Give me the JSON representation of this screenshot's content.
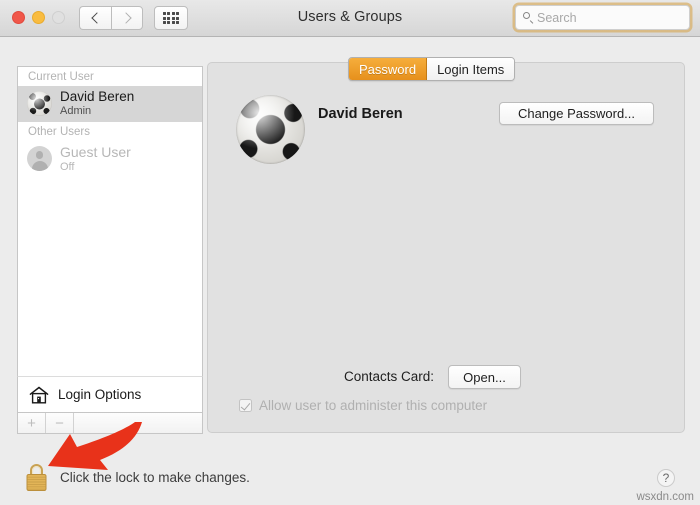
{
  "window": {
    "title": "Users & Groups",
    "traffic_lights": [
      "close",
      "minimize",
      "zoom"
    ],
    "nav": {
      "back": "back-chevron",
      "forward": "forward-chevron",
      "show_all": "grid-icon"
    },
    "search": {
      "placeholder": "Search",
      "value": "",
      "icon": "search-icon"
    }
  },
  "sidebar": {
    "groups": [
      {
        "header": "Current User",
        "users": [
          {
            "name": "David Beren",
            "sub": "Admin",
            "avatar": "soccer-ball-avatar",
            "selected": true,
            "dimmed": false
          }
        ]
      },
      {
        "header": "Other Users",
        "users": [
          {
            "name": "Guest User",
            "sub": "Off",
            "avatar": "person-silhouette-avatar",
            "selected": false,
            "dimmed": true
          }
        ]
      }
    ],
    "login_options": {
      "label": "Login Options",
      "icon": "house-icon"
    },
    "add_button": "+",
    "remove_button": "−"
  },
  "main": {
    "tabs": [
      {
        "label": "Password",
        "active": true
      },
      {
        "label": "Login Items",
        "active": false
      }
    ],
    "profile": {
      "name": "David Beren",
      "avatar": "soccer-ball-avatar"
    },
    "change_password_button": "Change Password...",
    "contacts_card_label": "Contacts Card:",
    "contacts_open_button": "Open...",
    "admin_checkbox": {
      "label": "Allow user to administer this computer",
      "checked": true,
      "disabled": true
    }
  },
  "footer": {
    "lock_icon": "closed-padlock-icon",
    "lock_text": "Click the lock to make changes.",
    "help_button": "?",
    "watermark": "wsxdn.com"
  },
  "annotation": {
    "arrow": "red-arrow-pointing-to-lock",
    "color": "#e8321a"
  },
  "colors": {
    "accent_tab": "#ec9a25",
    "search_focus_ring": "#d8b06a",
    "lock_gold": "#e2b457",
    "window_bg": "#ececec",
    "content_bg": "#e1e1e1"
  }
}
